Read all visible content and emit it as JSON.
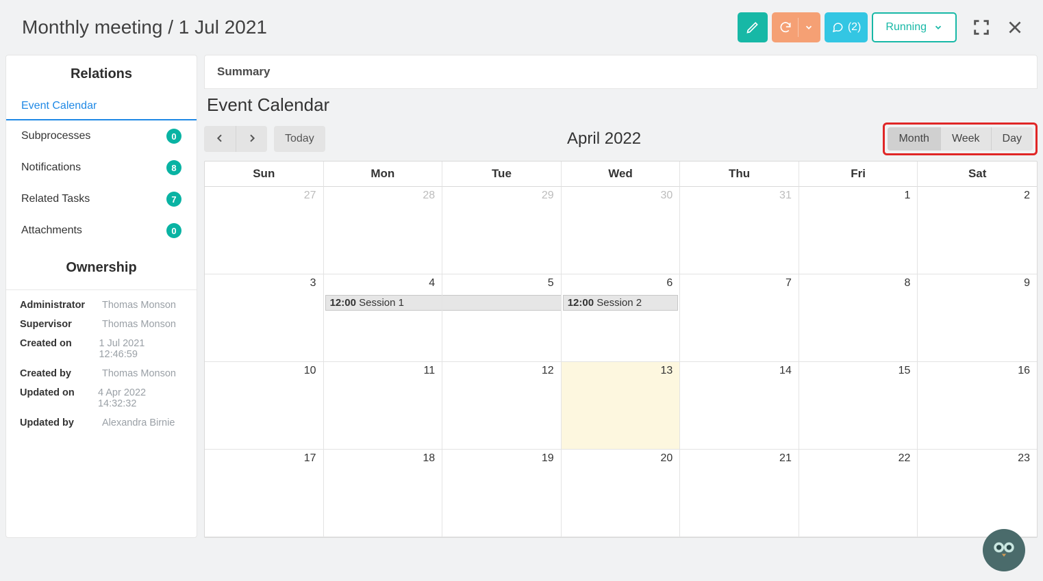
{
  "header": {
    "title": "Monthly meeting / 1 Jul 2021",
    "comments_label": "(2)",
    "status_label": "Running"
  },
  "sidebar": {
    "relations_title": "Relations",
    "items": [
      {
        "label": "Event Calendar",
        "badge": null,
        "active": true
      },
      {
        "label": "Subprocesses",
        "badge": "0",
        "active": false
      },
      {
        "label": "Notifications",
        "badge": "8",
        "active": false
      },
      {
        "label": "Related Tasks",
        "badge": "7",
        "active": false
      },
      {
        "label": "Attachments",
        "badge": "0",
        "active": false
      }
    ],
    "ownership_title": "Ownership",
    "ownership": [
      {
        "key": "Administrator",
        "val": "Thomas Monson"
      },
      {
        "key": "Supervisor",
        "val": "Thomas Monson"
      },
      {
        "key": "Created on",
        "val": "1 Jul 2021 12:46:59"
      },
      {
        "key": "Created by",
        "val": "Thomas Monson"
      },
      {
        "key": "Updated on",
        "val": "4 Apr 2022 14:32:32"
      },
      {
        "key": "Updated by",
        "val": "Alexandra Birnie"
      }
    ]
  },
  "main": {
    "summary_tab": "Summary",
    "panel_title": "Event Calendar",
    "today_label": "Today",
    "month_label": "April 2022",
    "view_buttons": {
      "month": "Month",
      "week": "Week",
      "day": "Day"
    },
    "day_headers": [
      "Sun",
      "Mon",
      "Tue",
      "Wed",
      "Thu",
      "Fri",
      "Sat"
    ],
    "weeks": [
      [
        {
          "n": "27",
          "other": true
        },
        {
          "n": "28",
          "other": true
        },
        {
          "n": "29",
          "other": true
        },
        {
          "n": "30",
          "other": true
        },
        {
          "n": "31",
          "other": true
        },
        {
          "n": "1"
        },
        {
          "n": "2"
        }
      ],
      [
        {
          "n": "3"
        },
        {
          "n": "4",
          "event": {
            "time": "12:00",
            "title": "Session 1",
            "span": true
          }
        },
        {
          "n": "5",
          "event_continuation": true
        },
        {
          "n": "6",
          "event": {
            "time": "12:00",
            "title": "Session 2"
          }
        },
        {
          "n": "7"
        },
        {
          "n": "8"
        },
        {
          "n": "9"
        }
      ],
      [
        {
          "n": "10"
        },
        {
          "n": "11"
        },
        {
          "n": "12"
        },
        {
          "n": "13",
          "today": true
        },
        {
          "n": "14"
        },
        {
          "n": "15"
        },
        {
          "n": "16"
        }
      ],
      [
        {
          "n": "17"
        },
        {
          "n": "18"
        },
        {
          "n": "19"
        },
        {
          "n": "20"
        },
        {
          "n": "21"
        },
        {
          "n": "22"
        },
        {
          "n": "23"
        }
      ]
    ]
  }
}
